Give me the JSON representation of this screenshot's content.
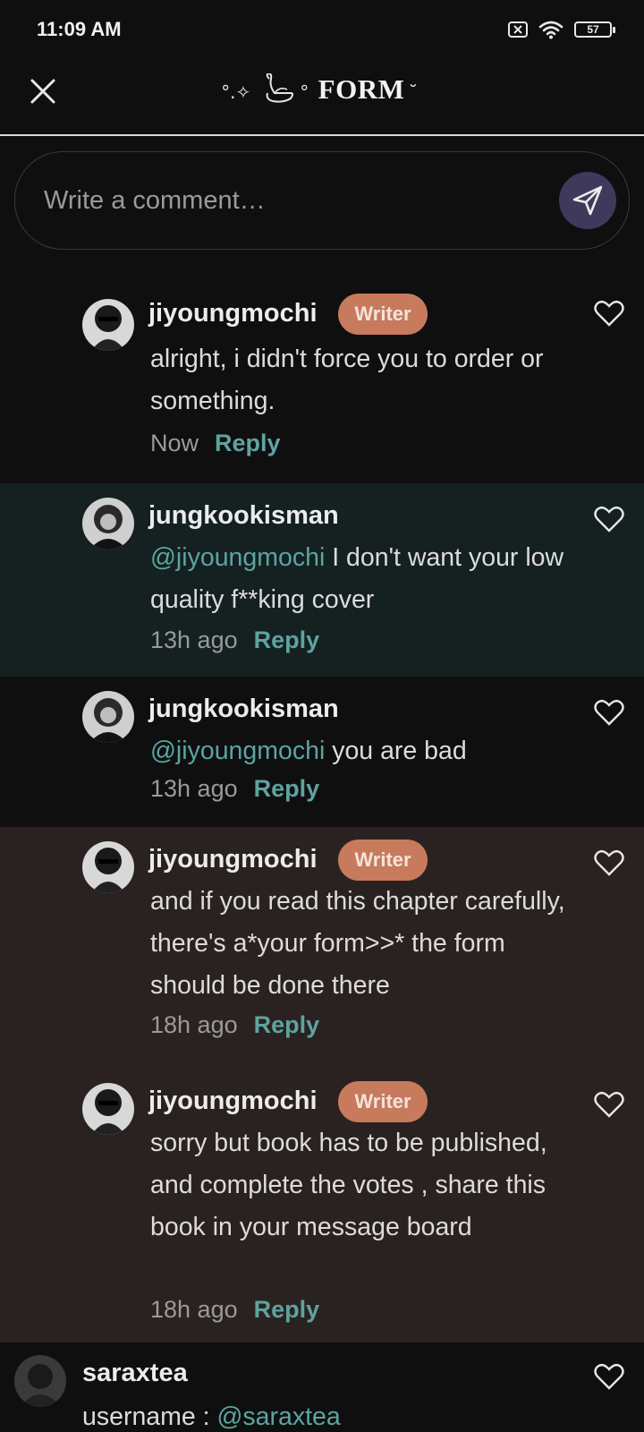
{
  "status": {
    "time": "11:09 AM",
    "battery": "57"
  },
  "header": {
    "title_deco": "°.✧",
    "title_deco2": "°",
    "title": "FORM",
    "title_tail": "˘"
  },
  "composer": {
    "placeholder": "Write a comment…"
  },
  "comments": [
    {
      "user": "jiyoungmochi",
      "badge": "Writer",
      "mention": "",
      "text": "alright, i didn't force you to order or something.",
      "time": "Now",
      "reply": "Reply"
    },
    {
      "user": "jungkookisman",
      "badge": "",
      "mention": "@jiyoungmochi",
      "text": " I don't want your low quality f**king cover",
      "time": "13h ago",
      "reply": "Reply"
    },
    {
      "user": "jungkookisman",
      "badge": "",
      "mention": "@jiyoungmochi",
      "text": " you are bad",
      "time": "13h ago",
      "reply": "Reply"
    },
    {
      "user": "jiyoungmochi",
      "badge": "Writer",
      "mention": "",
      "text": "and if you read this chapter carefully, there's a*your form>>* the form should be done there",
      "time": "18h ago",
      "reply": "Reply"
    },
    {
      "user": "jiyoungmochi",
      "badge": "Writer",
      "mention": "",
      "text": "sorry but book has to be published, and complete the votes , share this book in your message board",
      "time": "18h ago",
      "reply": "Reply"
    },
    {
      "user": "saraxtea",
      "badge": "",
      "mention": "@saraxtea",
      "text": "username : ",
      "time": "",
      "reply": ""
    }
  ],
  "colors": {
    "highlight_teal": "#152020",
    "highlight_brown": "#2a2220",
    "badge": "#c87a5c",
    "link": "#5ea3a0",
    "send": "#3e3a5c"
  },
  "icons": {
    "close": "close-icon",
    "send": "send-icon",
    "heart": "heart-icon",
    "wifi": "wifi-icon",
    "sim": "no-sim-icon",
    "battery": "battery-icon"
  }
}
